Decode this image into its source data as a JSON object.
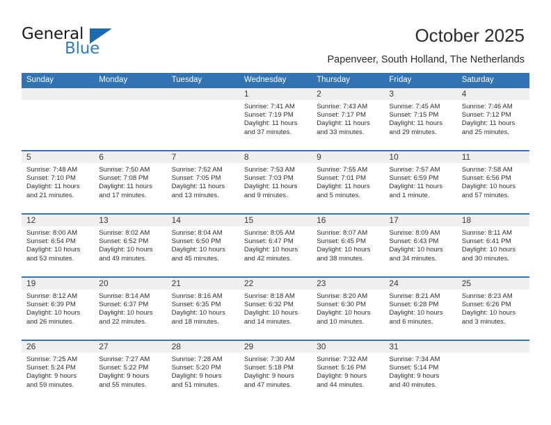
{
  "brand": {
    "name_part1": "General",
    "name_part2": "Blue",
    "accent_color": "#2e7cc4",
    "triangle_color": "#1a6bb0"
  },
  "header": {
    "title": "October 2025",
    "subtitle": "Papenveer, South Holland, The Netherlands"
  },
  "theme": {
    "header_blue": "#3173b3",
    "number_band": "#efefef"
  },
  "weekdays": [
    "Sunday",
    "Monday",
    "Tuesday",
    "Wednesday",
    "Thursday",
    "Friday",
    "Saturday"
  ],
  "labels": {
    "sunrise_prefix": "Sunrise: ",
    "sunset_prefix": "Sunset: ",
    "daylight_prefix": "Daylight: "
  },
  "weeks": [
    [
      {
        "day": "",
        "empty": true
      },
      {
        "day": "",
        "empty": true
      },
      {
        "day": "",
        "empty": true
      },
      {
        "day": "1",
        "sunrise": "Sunrise: 7:41 AM",
        "sunset": "Sunset: 7:19 PM",
        "daylight_line1": "Daylight: 11 hours",
        "daylight_line2": "and 37 minutes."
      },
      {
        "day": "2",
        "sunrise": "Sunrise: 7:43 AM",
        "sunset": "Sunset: 7:17 PM",
        "daylight_line1": "Daylight: 11 hours",
        "daylight_line2": "and 33 minutes."
      },
      {
        "day": "3",
        "sunrise": "Sunrise: 7:45 AM",
        "sunset": "Sunset: 7:15 PM",
        "daylight_line1": "Daylight: 11 hours",
        "daylight_line2": "and 29 minutes."
      },
      {
        "day": "4",
        "sunrise": "Sunrise: 7:46 AM",
        "sunset": "Sunset: 7:12 PM",
        "daylight_line1": "Daylight: 11 hours",
        "daylight_line2": "and 25 minutes."
      }
    ],
    [
      {
        "day": "5",
        "sunrise": "Sunrise: 7:48 AM",
        "sunset": "Sunset: 7:10 PM",
        "daylight_line1": "Daylight: 11 hours",
        "daylight_line2": "and 21 minutes."
      },
      {
        "day": "6",
        "sunrise": "Sunrise: 7:50 AM",
        "sunset": "Sunset: 7:08 PM",
        "daylight_line1": "Daylight: 11 hours",
        "daylight_line2": "and 17 minutes."
      },
      {
        "day": "7",
        "sunrise": "Sunrise: 7:52 AM",
        "sunset": "Sunset: 7:05 PM",
        "daylight_line1": "Daylight: 11 hours",
        "daylight_line2": "and 13 minutes."
      },
      {
        "day": "8",
        "sunrise": "Sunrise: 7:53 AM",
        "sunset": "Sunset: 7:03 PM",
        "daylight_line1": "Daylight: 11 hours",
        "daylight_line2": "and 9 minutes."
      },
      {
        "day": "9",
        "sunrise": "Sunrise: 7:55 AM",
        "sunset": "Sunset: 7:01 PM",
        "daylight_line1": "Daylight: 11 hours",
        "daylight_line2": "and 5 minutes."
      },
      {
        "day": "10",
        "sunrise": "Sunrise: 7:57 AM",
        "sunset": "Sunset: 6:59 PM",
        "daylight_line1": "Daylight: 11 hours",
        "daylight_line2": "and 1 minute."
      },
      {
        "day": "11",
        "sunrise": "Sunrise: 7:58 AM",
        "sunset": "Sunset: 6:56 PM",
        "daylight_line1": "Daylight: 10 hours",
        "daylight_line2": "and 57 minutes."
      }
    ],
    [
      {
        "day": "12",
        "sunrise": "Sunrise: 8:00 AM",
        "sunset": "Sunset: 6:54 PM",
        "daylight_line1": "Daylight: 10 hours",
        "daylight_line2": "and 53 minutes."
      },
      {
        "day": "13",
        "sunrise": "Sunrise: 8:02 AM",
        "sunset": "Sunset: 6:52 PM",
        "daylight_line1": "Daylight: 10 hours",
        "daylight_line2": "and 49 minutes."
      },
      {
        "day": "14",
        "sunrise": "Sunrise: 8:04 AM",
        "sunset": "Sunset: 6:50 PM",
        "daylight_line1": "Daylight: 10 hours",
        "daylight_line2": "and 45 minutes."
      },
      {
        "day": "15",
        "sunrise": "Sunrise: 8:05 AM",
        "sunset": "Sunset: 6:47 PM",
        "daylight_line1": "Daylight: 10 hours",
        "daylight_line2": "and 42 minutes."
      },
      {
        "day": "16",
        "sunrise": "Sunrise: 8:07 AM",
        "sunset": "Sunset: 6:45 PM",
        "daylight_line1": "Daylight: 10 hours",
        "daylight_line2": "and 38 minutes."
      },
      {
        "day": "17",
        "sunrise": "Sunrise: 8:09 AM",
        "sunset": "Sunset: 6:43 PM",
        "daylight_line1": "Daylight: 10 hours",
        "daylight_line2": "and 34 minutes."
      },
      {
        "day": "18",
        "sunrise": "Sunrise: 8:11 AM",
        "sunset": "Sunset: 6:41 PM",
        "daylight_line1": "Daylight: 10 hours",
        "daylight_line2": "and 30 minutes."
      }
    ],
    [
      {
        "day": "19",
        "sunrise": "Sunrise: 8:12 AM",
        "sunset": "Sunset: 6:39 PM",
        "daylight_line1": "Daylight: 10 hours",
        "daylight_line2": "and 26 minutes."
      },
      {
        "day": "20",
        "sunrise": "Sunrise: 8:14 AM",
        "sunset": "Sunset: 6:37 PM",
        "daylight_line1": "Daylight: 10 hours",
        "daylight_line2": "and 22 minutes."
      },
      {
        "day": "21",
        "sunrise": "Sunrise: 8:16 AM",
        "sunset": "Sunset: 6:35 PM",
        "daylight_line1": "Daylight: 10 hours",
        "daylight_line2": "and 18 minutes."
      },
      {
        "day": "22",
        "sunrise": "Sunrise: 8:18 AM",
        "sunset": "Sunset: 6:32 PM",
        "daylight_line1": "Daylight: 10 hours",
        "daylight_line2": "and 14 minutes."
      },
      {
        "day": "23",
        "sunrise": "Sunrise: 8:20 AM",
        "sunset": "Sunset: 6:30 PM",
        "daylight_line1": "Daylight: 10 hours",
        "daylight_line2": "and 10 minutes."
      },
      {
        "day": "24",
        "sunrise": "Sunrise: 8:21 AM",
        "sunset": "Sunset: 6:28 PM",
        "daylight_line1": "Daylight: 10 hours",
        "daylight_line2": "and 6 minutes."
      },
      {
        "day": "25",
        "sunrise": "Sunrise: 8:23 AM",
        "sunset": "Sunset: 6:26 PM",
        "daylight_line1": "Daylight: 10 hours",
        "daylight_line2": "and 3 minutes."
      }
    ],
    [
      {
        "day": "26",
        "sunrise": "Sunrise: 7:25 AM",
        "sunset": "Sunset: 5:24 PM",
        "daylight_line1": "Daylight: 9 hours",
        "daylight_line2": "and 59 minutes."
      },
      {
        "day": "27",
        "sunrise": "Sunrise: 7:27 AM",
        "sunset": "Sunset: 5:22 PM",
        "daylight_line1": "Daylight: 9 hours",
        "daylight_line2": "and 55 minutes."
      },
      {
        "day": "28",
        "sunrise": "Sunrise: 7:28 AM",
        "sunset": "Sunset: 5:20 PM",
        "daylight_line1": "Daylight: 9 hours",
        "daylight_line2": "and 51 minutes."
      },
      {
        "day": "29",
        "sunrise": "Sunrise: 7:30 AM",
        "sunset": "Sunset: 5:18 PM",
        "daylight_line1": "Daylight: 9 hours",
        "daylight_line2": "and 47 minutes."
      },
      {
        "day": "30",
        "sunrise": "Sunrise: 7:32 AM",
        "sunset": "Sunset: 5:16 PM",
        "daylight_line1": "Daylight: 9 hours",
        "daylight_line2": "and 44 minutes."
      },
      {
        "day": "31",
        "sunrise": "Sunrise: 7:34 AM",
        "sunset": "Sunset: 5:14 PM",
        "daylight_line1": "Daylight: 9 hours",
        "daylight_line2": "and 40 minutes."
      },
      {
        "day": "",
        "empty": true
      }
    ]
  ]
}
